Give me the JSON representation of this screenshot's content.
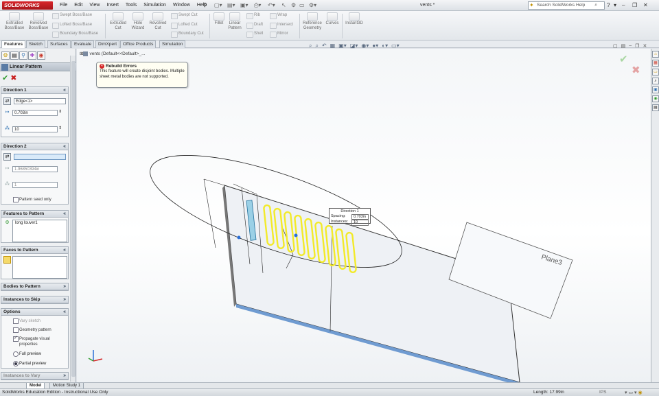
{
  "app": {
    "logo": "SOLIDWORKS",
    "document_title": "vents *",
    "menus": [
      "File",
      "Edit",
      "View",
      "Insert",
      "Tools",
      "Simulation",
      "Window",
      "Help"
    ],
    "search_placeholder": "Search SolidWorks Help"
  },
  "ribbon": {
    "big_buttons": [
      {
        "label1": "Extruded",
        "label2": "Boss/Base"
      },
      {
        "label1": "Revolved",
        "label2": "Boss/Base"
      },
      {
        "label1": "Extruded",
        "label2": "Cut"
      },
      {
        "label1": "Hole",
        "label2": "Wizard"
      },
      {
        "label1": "Revolved",
        "label2": "Cut"
      },
      {
        "label1": "Fillet",
        "label2": ""
      },
      {
        "label1": "Linear",
        "label2": "Pattern"
      },
      {
        "label1": "Reference",
        "label2": "Geometry"
      },
      {
        "label1": "Curves",
        "label2": ""
      },
      {
        "label1": "Instant3D",
        "label2": ""
      }
    ],
    "small_buttons": {
      "swept_boss": "Swept Boss/Base",
      "lofted_boss": "Lofted Boss/Base",
      "boundary_boss": "Boundary Boss/Base",
      "swept_cut": "Swept Cut",
      "lofted_cut": "Lofted Cut",
      "boundary_cut": "Boundary Cut",
      "rib": "Rib",
      "draft": "Draft",
      "shell": "Shell",
      "wrap": "Wrap",
      "intersect": "Intersect",
      "mirror": "Mirror"
    }
  },
  "cm_tabs": [
    "Features",
    "Sketch",
    "Surfaces",
    "Evaluate",
    "DimXpert",
    "Office Products",
    "Simulation"
  ],
  "property_manager": {
    "title": "Linear Pattern",
    "help": "?",
    "direction1": {
      "header": "Direction 1",
      "edge": "Edge<1>",
      "spacing": "0.703in",
      "instances": "10"
    },
    "direction2": {
      "header": "Direction 2",
      "edge": "",
      "spacing": "1.96850394in",
      "instances": "1",
      "seed_only": "Pattern seed only"
    },
    "features": {
      "header": "Features to Pattern",
      "item": "long louver1"
    },
    "faces": {
      "header": "Faces to Pattern"
    },
    "bodies": {
      "header": "Bodies to Pattern"
    },
    "skip": {
      "header": "Instances to Skip"
    },
    "options": {
      "header": "Options",
      "vary_sketch": "Vary sketch",
      "geometry_pattern": "Geometry pattern",
      "propagate": "Propagate visual properties",
      "full_preview": "Full preview",
      "partial_preview": "Partial preview"
    },
    "vary": {
      "header": "Instances to Vary"
    }
  },
  "viewport": {
    "tree_path": "vents (Default<<Default>_...",
    "rebuild": {
      "title": "Rebuild Errors",
      "text": "This feature will create disjoint bodies. Multiple sheet metal bodies are not supported."
    },
    "callout": {
      "title": "Direction 1",
      "spacing_label": "Spacing:",
      "spacing_value": "0.703in",
      "instances_label": "Instances:",
      "instances_value": "10"
    },
    "plane_label": "Plane3"
  },
  "bottom_tabs": [
    "Model",
    "Motion Study 1"
  ],
  "status": {
    "left": "SolidWorks Education Edition - Instructional Use Only",
    "length": "Length: 17.99in",
    "units": "IPS"
  },
  "colors": {
    "preview_yellow": "#f2ea2a",
    "selection_blue": "#2a6fd6",
    "error_red": "#d42424",
    "ok_green": "#2e9b2e"
  }
}
